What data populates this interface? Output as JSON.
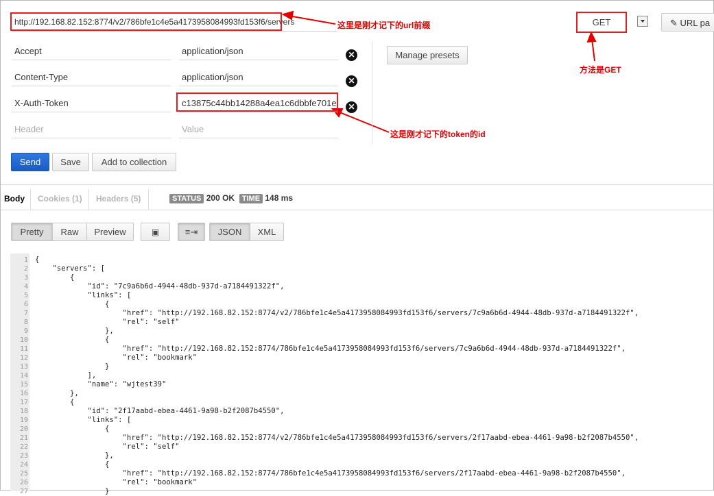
{
  "request": {
    "url": "http://192.168.82.152:8774/v2/786bfe1c4e5a4173958084993fd153f6/servers",
    "method": "GET",
    "url_params_label": "URL pa"
  },
  "annotations": {
    "url_note": "这里是刚才记下的url前缀",
    "method_note": "方法是GET",
    "token_note": "这是刚才记下的token的id"
  },
  "headers": [
    {
      "key": "Accept",
      "value": "application/json"
    },
    {
      "key": "Content-Type",
      "value": "application/json"
    },
    {
      "key": "X-Auth-Token",
      "value": "c13875c44bb14288a4ea1c6dbbfe701e"
    }
  ],
  "header_placeholders": {
    "key": "Header",
    "value": "Value"
  },
  "buttons": {
    "manage_presets": "Manage presets",
    "send": "Send",
    "save": "Save",
    "add_to_collection": "Add to collection"
  },
  "response_tabs": {
    "body": "Body",
    "cookies": "Cookies (1)",
    "headers": "Headers (5)"
  },
  "status": {
    "status_label": "STATUS",
    "status_value": "200 OK",
    "time_label": "TIME",
    "time_value": "148 ms"
  },
  "view_modes": {
    "pretty": "Pretty",
    "raw": "Raw",
    "preview": "Preview",
    "json": "JSON",
    "xml": "XML"
  },
  "code_lines": [
    "{",
    "    \"servers\": [",
    "        {",
    "            \"id\": \"7c9a6b6d-4944-48db-937d-a7184491322f\",",
    "            \"links\": [",
    "                {",
    "                    \"href\": \"http://192.168.82.152:8774/v2/786bfe1c4e5a4173958084993fd153f6/servers/7c9a6b6d-4944-48db-937d-a7184491322f\",",
    "                    \"rel\": \"self\"",
    "                },",
    "                {",
    "                    \"href\": \"http://192.168.82.152:8774/786bfe1c4e5a4173958084993fd153f6/servers/7c9a6b6d-4944-48db-937d-a7184491322f\",",
    "                    \"rel\": \"bookmark\"",
    "                }",
    "            ],",
    "            \"name\": \"wjtest39\"",
    "        },",
    "        {",
    "            \"id\": \"2f17aabd-ebea-4461-9a98-b2f2087b4550\",",
    "            \"links\": [",
    "                {",
    "                    \"href\": \"http://192.168.82.152:8774/v2/786bfe1c4e5a4173958084993fd153f6/servers/2f17aabd-ebea-4461-9a98-b2f2087b4550\",",
    "                    \"rel\": \"self\"",
    "                },",
    "                {",
    "                    \"href\": \"http://192.168.82.152:8774/786bfe1c4e5a4173958084993fd153f6/servers/2f17aabd-ebea-4461-9a98-b2f2087b4550\",",
    "                    \"rel\": \"bookmark\"",
    "                }"
  ],
  "colors": {
    "annotation_red": "#e00000",
    "send_blue": "#1a5bc4",
    "json_string": "#1a1aa6"
  }
}
